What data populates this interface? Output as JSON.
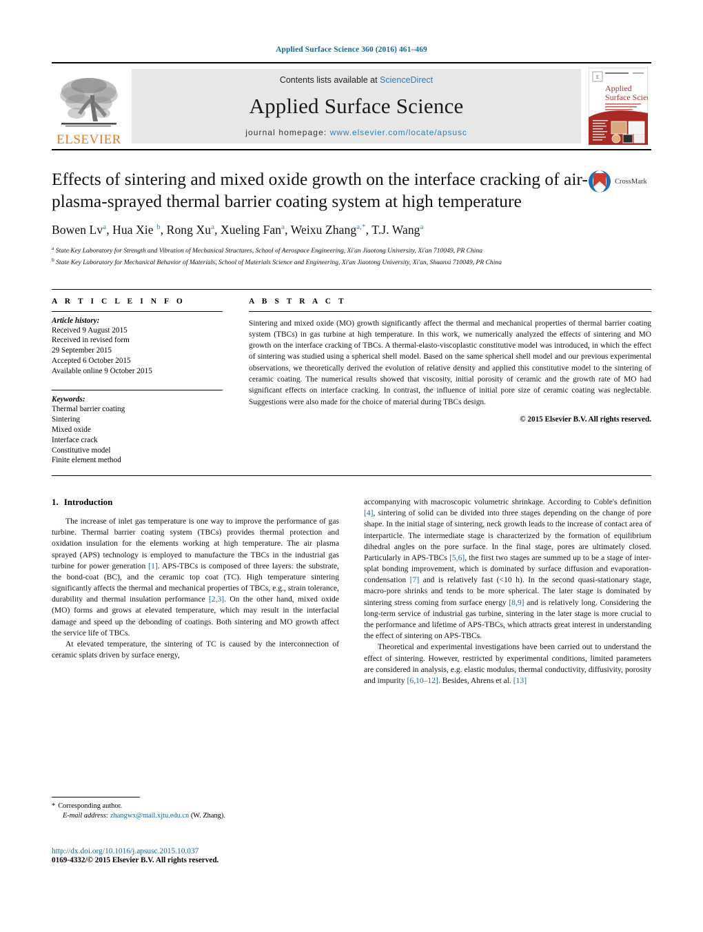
{
  "running_head": "Applied Surface Science 360 (2016) 461–469",
  "masthead": {
    "publisher_logo_text": "ELSEVIER",
    "contents_prefix": "Contents lists available at ",
    "contents_link": "ScienceDirect",
    "journal_title": "Applied Surface Science",
    "homepage_prefix": "journal homepage: ",
    "homepage_url": "www.elsevier.com/locate/apsusc",
    "cover_title_line1": "Applied",
    "cover_title_line2": "Surface Science"
  },
  "article": {
    "title": "Effects of sintering and mixed oxide growth on the interface cracking of air-plasma-sprayed thermal barrier coating system at high temperature",
    "crossmark_label": "CrossMark",
    "authors_html": "Bowen Lv<sup>a</sup>, Hua Xie <sup>b</sup>, Rong Xu<sup>a</sup>, Xueling Fan<sup>a</sup>, Weixu Zhang<sup>a,*</sup>, T.J. Wang<sup>a</sup>",
    "affiliations": [
      {
        "marker": "a",
        "text": "State Key Laboratory for Strength and Vibration of Mechanical Structures, School of Aerospace Engineering, Xi'an Jiaotong University, Xi'an 710049, PR China"
      },
      {
        "marker": "b",
        "text": "State Key Laboratory for Mechanical Behavior of Materials, School of Materials Science and Engineering, Xi'an Jiaotong University, Xi'an, Shaanxi 710049, PR China"
      }
    ]
  },
  "article_info": {
    "heading": "A R T I C L E I N F O",
    "history_label": "Article history:",
    "history": [
      "Received 9 August 2015",
      "Received in revised form",
      "29 September 2015",
      "Accepted 6 October 2015",
      "Available online 9 October 2015"
    ],
    "keywords_label": "Keywords:",
    "keywords": [
      "Thermal barrier coating",
      "Sintering",
      "Mixed oxide",
      "Interface crack",
      "Constitutive model",
      "Finite element method"
    ]
  },
  "abstract": {
    "heading": "A B S T R A C T",
    "text": "Sintering and mixed oxide (MO) growth significantly affect the thermal and mechanical properties of thermal barrier coating system (TBCs) in gas turbine at high temperature. In this work, we numerically analyzed the effects of sintering and MO growth on the interface cracking of TBCs. A thermal-elasto-viscoplastic constitutive model was introduced, in which the effect of sintering was studied using a spherical shell model. Based on the same spherical shell model and our previous experimental observations, we theoretically derived the evolution of relative density and applied this constitutive model to the sintering of ceramic coating. The numerical results showed that viscosity, initial porosity of ceramic and the growth rate of MO had significant effects on interface cracking. In contrast, the influence of initial pore size of ceramic coating was neglectable. Suggestions were also made for the choice of material during TBCs design.",
    "copyright": "© 2015 Elsevier B.V. All rights reserved."
  },
  "introduction": {
    "number": "1.",
    "title": "Introduction",
    "left_paragraphs": [
      "The increase of inlet gas temperature is one way to improve the performance of gas turbine. Thermal barrier coating system (TBCs) provides thermal protection and oxidation insulation for the elements working at high temperature. The air plasma sprayed (APS) technology is employed to manufacture the TBCs in the industrial gas turbine for power generation [1]. APS-TBCs is composed of three layers: the substrate, the bond-coat (BC), and the ceramic top coat (TC). High temperature sintering significantly affects the thermal and mechanical properties of TBCs, e.g., strain tolerance, durability and thermal insulation performance [2,3]. On the other hand, mixed oxide (MO) forms and grows at elevated temperature, which may result in the interfacial damage and speed up the debonding of coatings. Both sintering and MO growth affect the service life of TBCs.",
      "At elevated temperature, the sintering of TC is caused by the interconnection of ceramic splats driven by surface energy,"
    ],
    "right_paragraphs": [
      "accompanying with macroscopic volumetric shrinkage. According to Coble's definition [4], sintering of solid can be divided into three stages depending on the change of pore shape. In the initial stage of sintering, neck growth leads to the increase of contact area of interparticle. The intermediate stage is characterized by the formation of equilibrium dihedral angles on the pore surface. In the final stage, pores are ultimately closed. Particularly in APS-TBCs [5,6], the first two stages are summed up to be a stage of inter-splat bonding improvement, which is dominated by surface diffusion and evaporation-condensation [7] and is relatively fast (<10 h). In the second quasi-stationary stage, macro-pore shrinks and tends to be more spherical. The later stage is dominated by sintering stress coming from surface energy [8,9] and is relatively long. Considering the long-term service of industrial gas turbine, sintering in the later stage is more crucial to the performance and lifetime of APS-TBCs, which attracts great interest in understanding the effect of sintering on APS-TBCs.",
      "Theoretical and experimental investigations have been carried out to understand the effect of sintering. However, restricted by experimental conditions, limited parameters are considered in analysis, e.g. elastic modulus, thermal conductivity, diffusivity, porosity and impurity [6,10–12]. Besides, Ahrens et al. [13]"
    ]
  },
  "footer": {
    "corresponding_marker": "*",
    "corresponding_text": "Corresponding author.",
    "email_label": "E-mail address:",
    "email": "zhangwx@mail.xjtu.edu.cn",
    "email_suffix": "(W. Zhang).",
    "doi": "http://dx.doi.org/10.1016/j.apsusc.2015.10.037",
    "issn_line": "0169-4332/© 2015 Elsevier B.V. All rights reserved."
  },
  "colors": {
    "link": "#1a6496",
    "elsevier_orange": "#E87722",
    "crossmark_red": "#C8352B",
    "band_gray": "#e7e7e7"
  }
}
